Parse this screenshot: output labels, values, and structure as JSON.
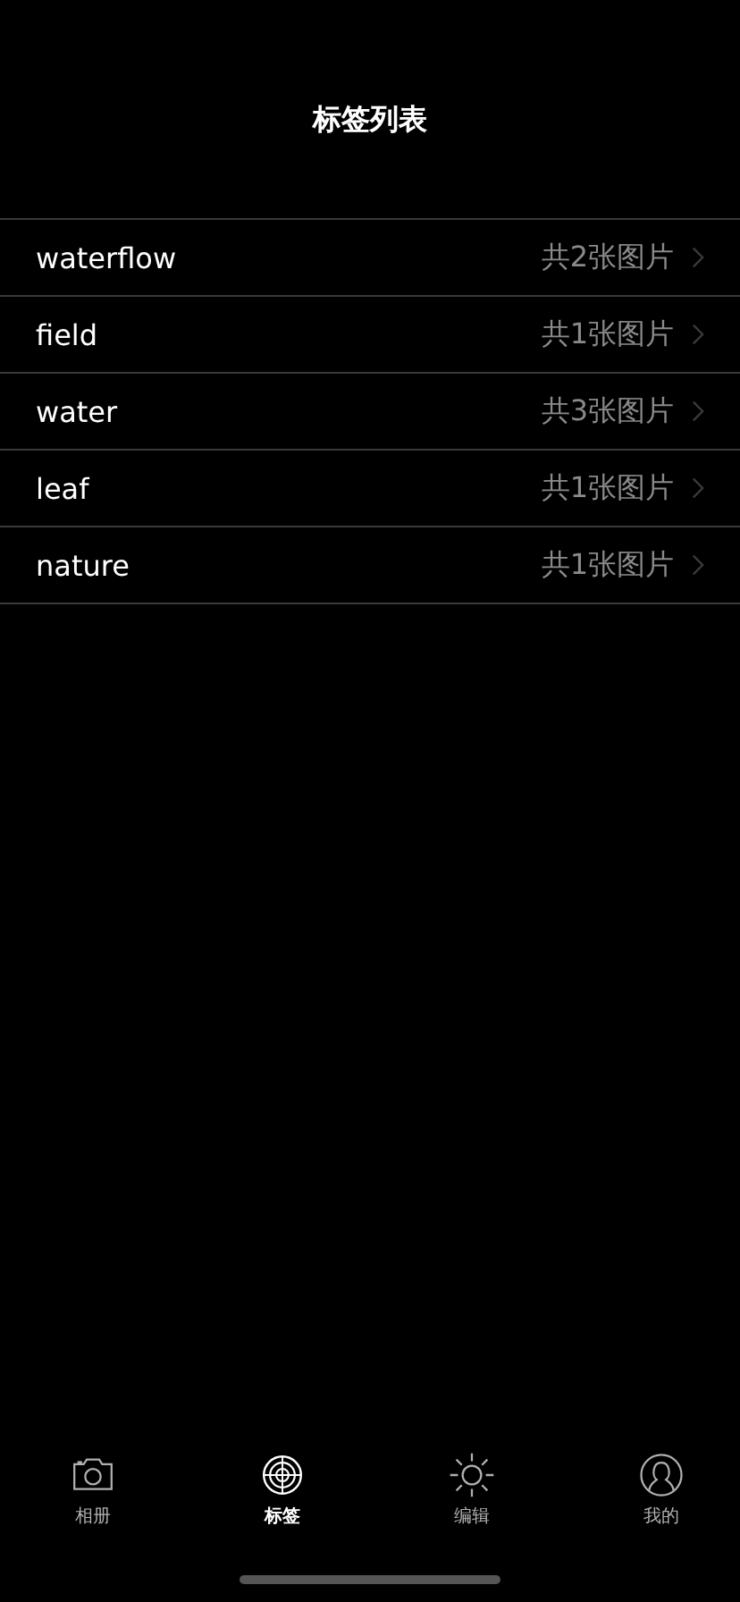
{
  "header": {
    "title": "标签列表"
  },
  "tags": [
    {
      "name": "waterflow",
      "count": "共2张图片"
    },
    {
      "name": "field",
      "count": "共1张图片"
    },
    {
      "name": "water",
      "count": "共3张图片"
    },
    {
      "name": "leaf",
      "count": "共1张图片"
    },
    {
      "name": "nature",
      "count": "共1张图片"
    }
  ],
  "tab_bar": [
    {
      "kind": "camera",
      "label": "相册",
      "selected": false
    },
    {
      "kind": "target",
      "label": "标签",
      "selected": true
    },
    {
      "kind": "sun",
      "label": "编辑",
      "selected": false
    },
    {
      "kind": "person",
      "label": "我的",
      "selected": false
    }
  ]
}
